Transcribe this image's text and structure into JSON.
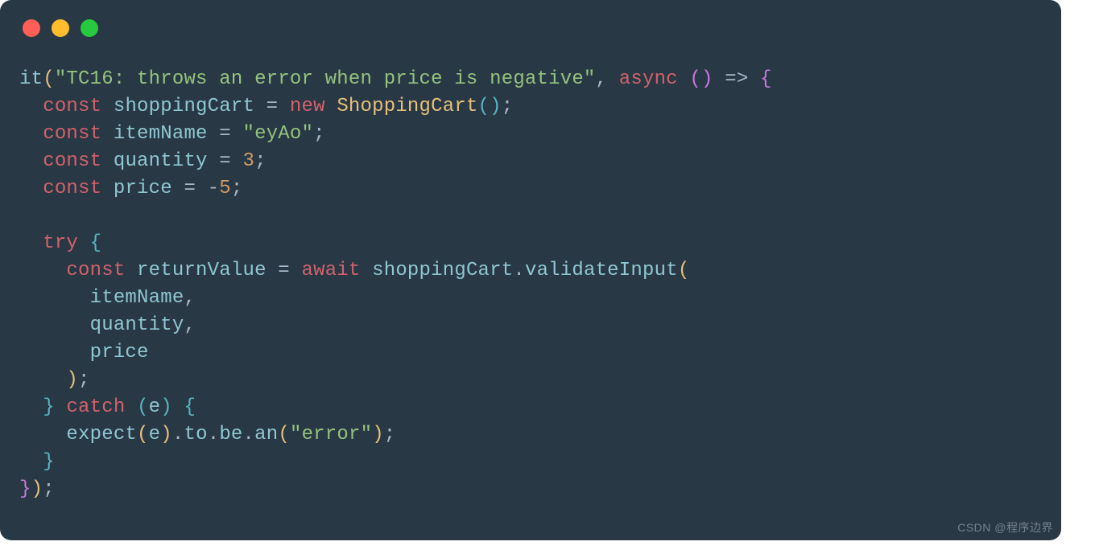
{
  "watermark": "CSDN @程序边界",
  "code": {
    "line1": {
      "fn": "it",
      "lparen": "(",
      "str": "\"TC16: throws an error when price is negative\"",
      "comma": ", ",
      "kw_async": "async ",
      "args_l": "(",
      "args_r": ")",
      "arrow": " => ",
      "brace_l": "{"
    },
    "line2": {
      "indent": "  ",
      "kw_const": "const ",
      "ident": "shoppingCart",
      "eq": " = ",
      "kw_new": "new ",
      "type": "ShoppingCart",
      "lparen": "(",
      "rparen": ")",
      "semi": ";"
    },
    "line3": {
      "indent": "  ",
      "kw_const": "const ",
      "ident": "itemName",
      "eq": " = ",
      "str": "\"eyAo\"",
      "semi": ";"
    },
    "line4": {
      "indent": "  ",
      "kw_const": "const ",
      "ident": "quantity",
      "eq": " = ",
      "num": "3",
      "semi": ";"
    },
    "line5": {
      "indent": "  ",
      "kw_const": "const ",
      "ident": "price",
      "eq": " = ",
      "neg": "-",
      "num": "5",
      "semi": ";"
    },
    "line6": "",
    "line7": {
      "indent": "  ",
      "kw_try": "try ",
      "brace_l": "{"
    },
    "line8": {
      "indent": "    ",
      "kw_const": "const ",
      "ident": "returnValue",
      "eq": " = ",
      "kw_await": "await ",
      "obj": "shoppingCart",
      "dot": ".",
      "method": "validateInput",
      "lparen": "("
    },
    "line9": {
      "indent": "      ",
      "ident": "itemName",
      "comma": ","
    },
    "line10": {
      "indent": "      ",
      "ident": "quantity",
      "comma": ","
    },
    "line11": {
      "indent": "      ",
      "ident": "price"
    },
    "line12": {
      "indent": "    ",
      "rparen": ")",
      "semi": ";"
    },
    "line13": {
      "indent": "  ",
      "brace_r": "}",
      "sp": " ",
      "kw_catch": "catch ",
      "lparen": "(",
      "ident": "e",
      "rparen": ")",
      "sp2": " ",
      "brace_l": "{"
    },
    "line14": {
      "indent": "    ",
      "fn": "expect",
      "lparen": "(",
      "arg": "e",
      "rparen": ")",
      "dot1": ".",
      "p1": "to",
      "dot2": ".",
      "p2": "be",
      "dot3": ".",
      "p3": "an",
      "lparen2": "(",
      "str": "\"error\"",
      "rparen2": ")",
      "semi": ";"
    },
    "line15": {
      "indent": "  ",
      "brace_r": "}"
    },
    "line16": {
      "brace_r": "}",
      "rparen": ")",
      "semi": ";"
    }
  }
}
